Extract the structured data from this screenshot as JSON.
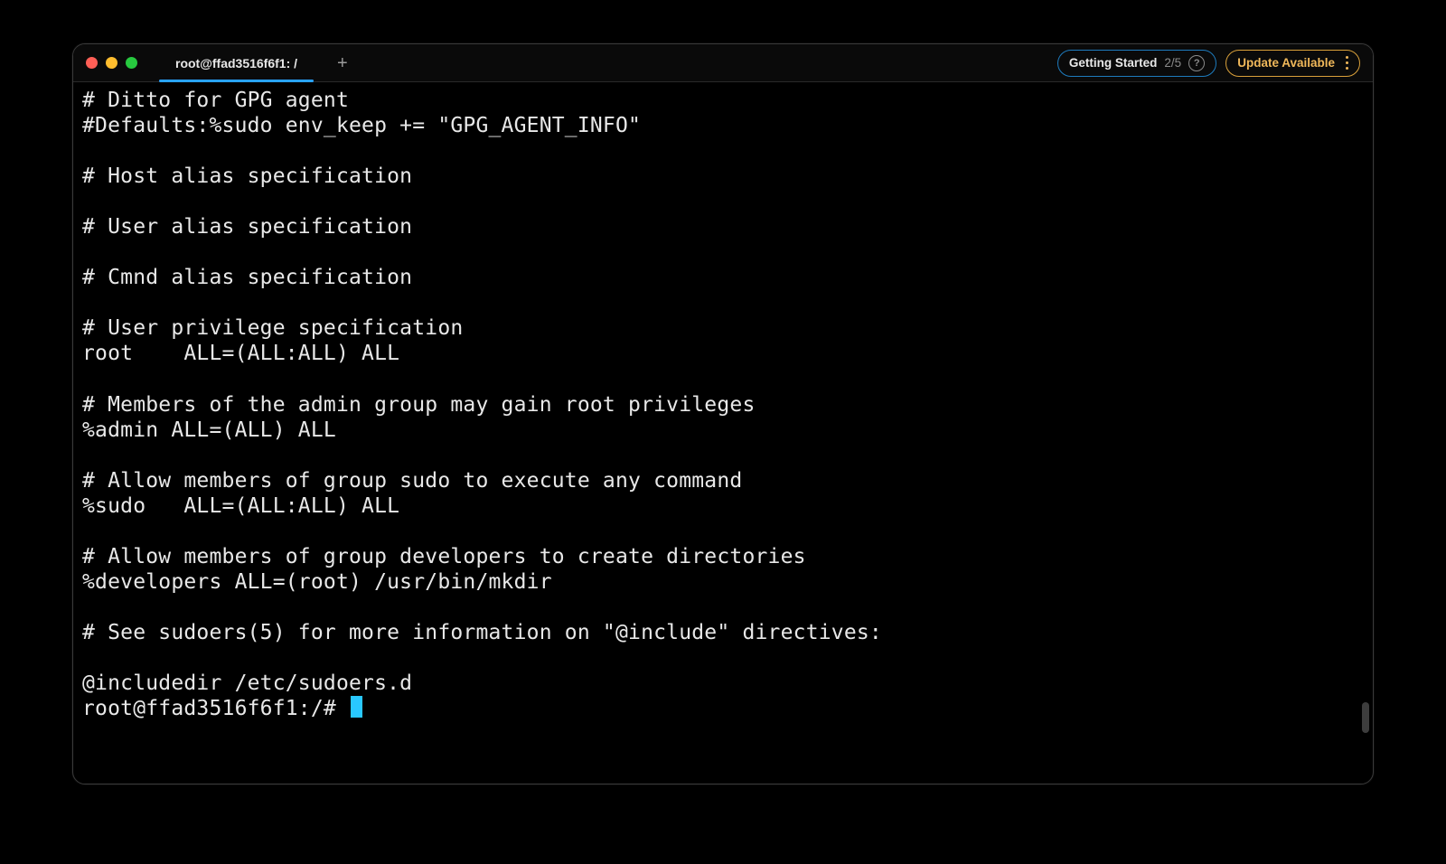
{
  "window": {
    "traffic_lights": [
      "close",
      "minimize",
      "zoom"
    ]
  },
  "tab": {
    "title": "root@ffad3516f6f1: /",
    "active": true
  },
  "new_tab_glyph": "+",
  "getting_started": {
    "label": "Getting Started",
    "progress": "2/5",
    "help_glyph": "?"
  },
  "update": {
    "label": "Update Available"
  },
  "terminal": {
    "lines": [
      "# Ditto for GPG agent",
      "#Defaults:%sudo env_keep += \"GPG_AGENT_INFO\"",
      "",
      "# Host alias specification",
      "",
      "# User alias specification",
      "",
      "# Cmnd alias specification",
      "",
      "# User privilege specification",
      "root    ALL=(ALL:ALL) ALL",
      "",
      "# Members of the admin group may gain root privileges",
      "%admin ALL=(ALL) ALL",
      "",
      "# Allow members of group sudo to execute any command",
      "%sudo   ALL=(ALL:ALL) ALL",
      "",
      "# Allow members of group developers to create directories",
      "%developers ALL=(root) /usr/bin/mkdir",
      "",
      "# See sudoers(5) for more information on \"@include\" directives:",
      "",
      "@includedir /etc/sudoers.d"
    ],
    "prompt": "root@ffad3516f6f1:/# "
  }
}
